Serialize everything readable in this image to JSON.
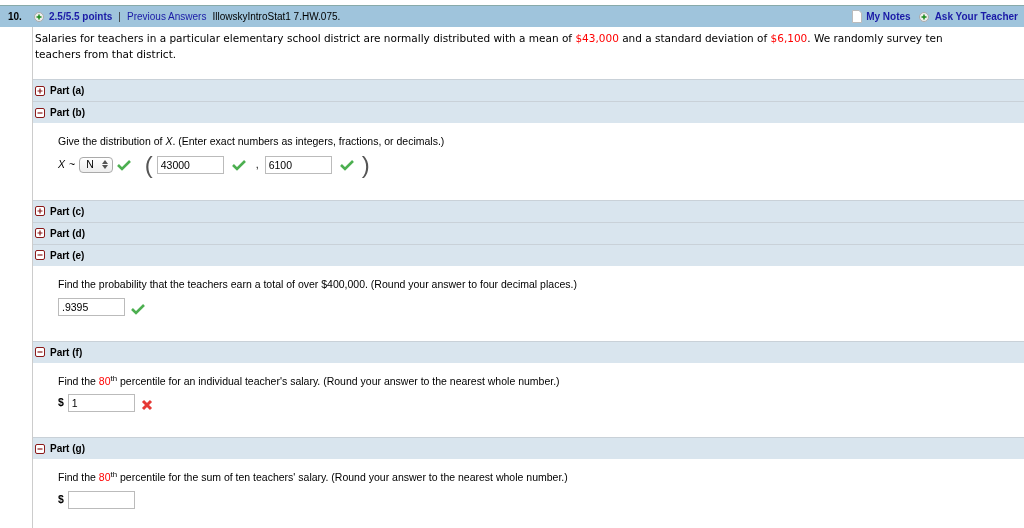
{
  "header": {
    "number": "10.",
    "points": "2.5/5.5 points",
    "separator": "|",
    "previous_answers": "Previous Answers",
    "assignment": "IllowskyIntroStat1 7.HW.075.",
    "my_notes": "My Notes",
    "ask_teacher": "Ask Your Teacher"
  },
  "intro": [
    {
      "kind": "plain",
      "text": "Salaries for teachers in a particular elementary school district are normally distributed with a mean of "
    },
    {
      "kind": "highlight",
      "text": "$43,000"
    },
    {
      "kind": "plain",
      "text": " and a standard deviation of "
    },
    {
      "kind": "highlight",
      "text": "$6,100"
    },
    {
      "kind": "plain",
      "text": ". We randomly survey ten teachers from that district."
    }
  ],
  "parts": [
    {
      "label": "Part (a)",
      "expanded": false
    },
    {
      "label": "Part (b)",
      "expanded": true,
      "kind": "distribution",
      "prompt": [
        {
          "kind": "plain",
          "text": "Give the distribution of "
        },
        {
          "kind": "italic",
          "text": "X"
        },
        {
          "kind": "plain",
          "text": ". (Enter exact numbers as integers, fractions, or decimals.)"
        }
      ],
      "variable": "X",
      "tilde": "~",
      "dist": "N",
      "dist_correct": true,
      "open_paren": "(",
      "comma": ",",
      "close_paren": ")",
      "params": [
        {
          "value": "43000",
          "correct": true
        },
        {
          "value": "6100",
          "correct": true
        }
      ]
    },
    {
      "label": "Part (c)",
      "expanded": false
    },
    {
      "label": "Part (d)",
      "expanded": false
    },
    {
      "label": "Part (e)",
      "expanded": true,
      "kind": "answer",
      "prompt": [
        {
          "kind": "plain",
          "text": "Find the probability that the teachers earn a total of over $400,000. (Round your answer to four decimal places.)"
        }
      ],
      "value": ".9395",
      "correct": true
    },
    {
      "label": "Part (f)",
      "expanded": true,
      "kind": "answer",
      "prompt": [
        {
          "kind": "plain",
          "text": "Find the "
        },
        {
          "kind": "highlight",
          "text": "80"
        },
        {
          "kind": "sup",
          "text": "th"
        },
        {
          "kind": "plain",
          "text": " percentile for an individual teacher's salary. (Round your answer to the nearest whole number.)"
        }
      ],
      "prefix": "$",
      "value": "1",
      "correct": false
    },
    {
      "label": "Part (g)",
      "expanded": true,
      "kind": "answer",
      "prompt": [
        {
          "kind": "plain",
          "text": "Find the "
        },
        {
          "kind": "highlight",
          "text": "80"
        },
        {
          "kind": "sup",
          "text": "th"
        },
        {
          "kind": "plain",
          "text": " percentile for the sum of ten teachers' salary. (Round your answer to the nearest whole number.)"
        }
      ],
      "prefix": "$"
    }
  ]
}
